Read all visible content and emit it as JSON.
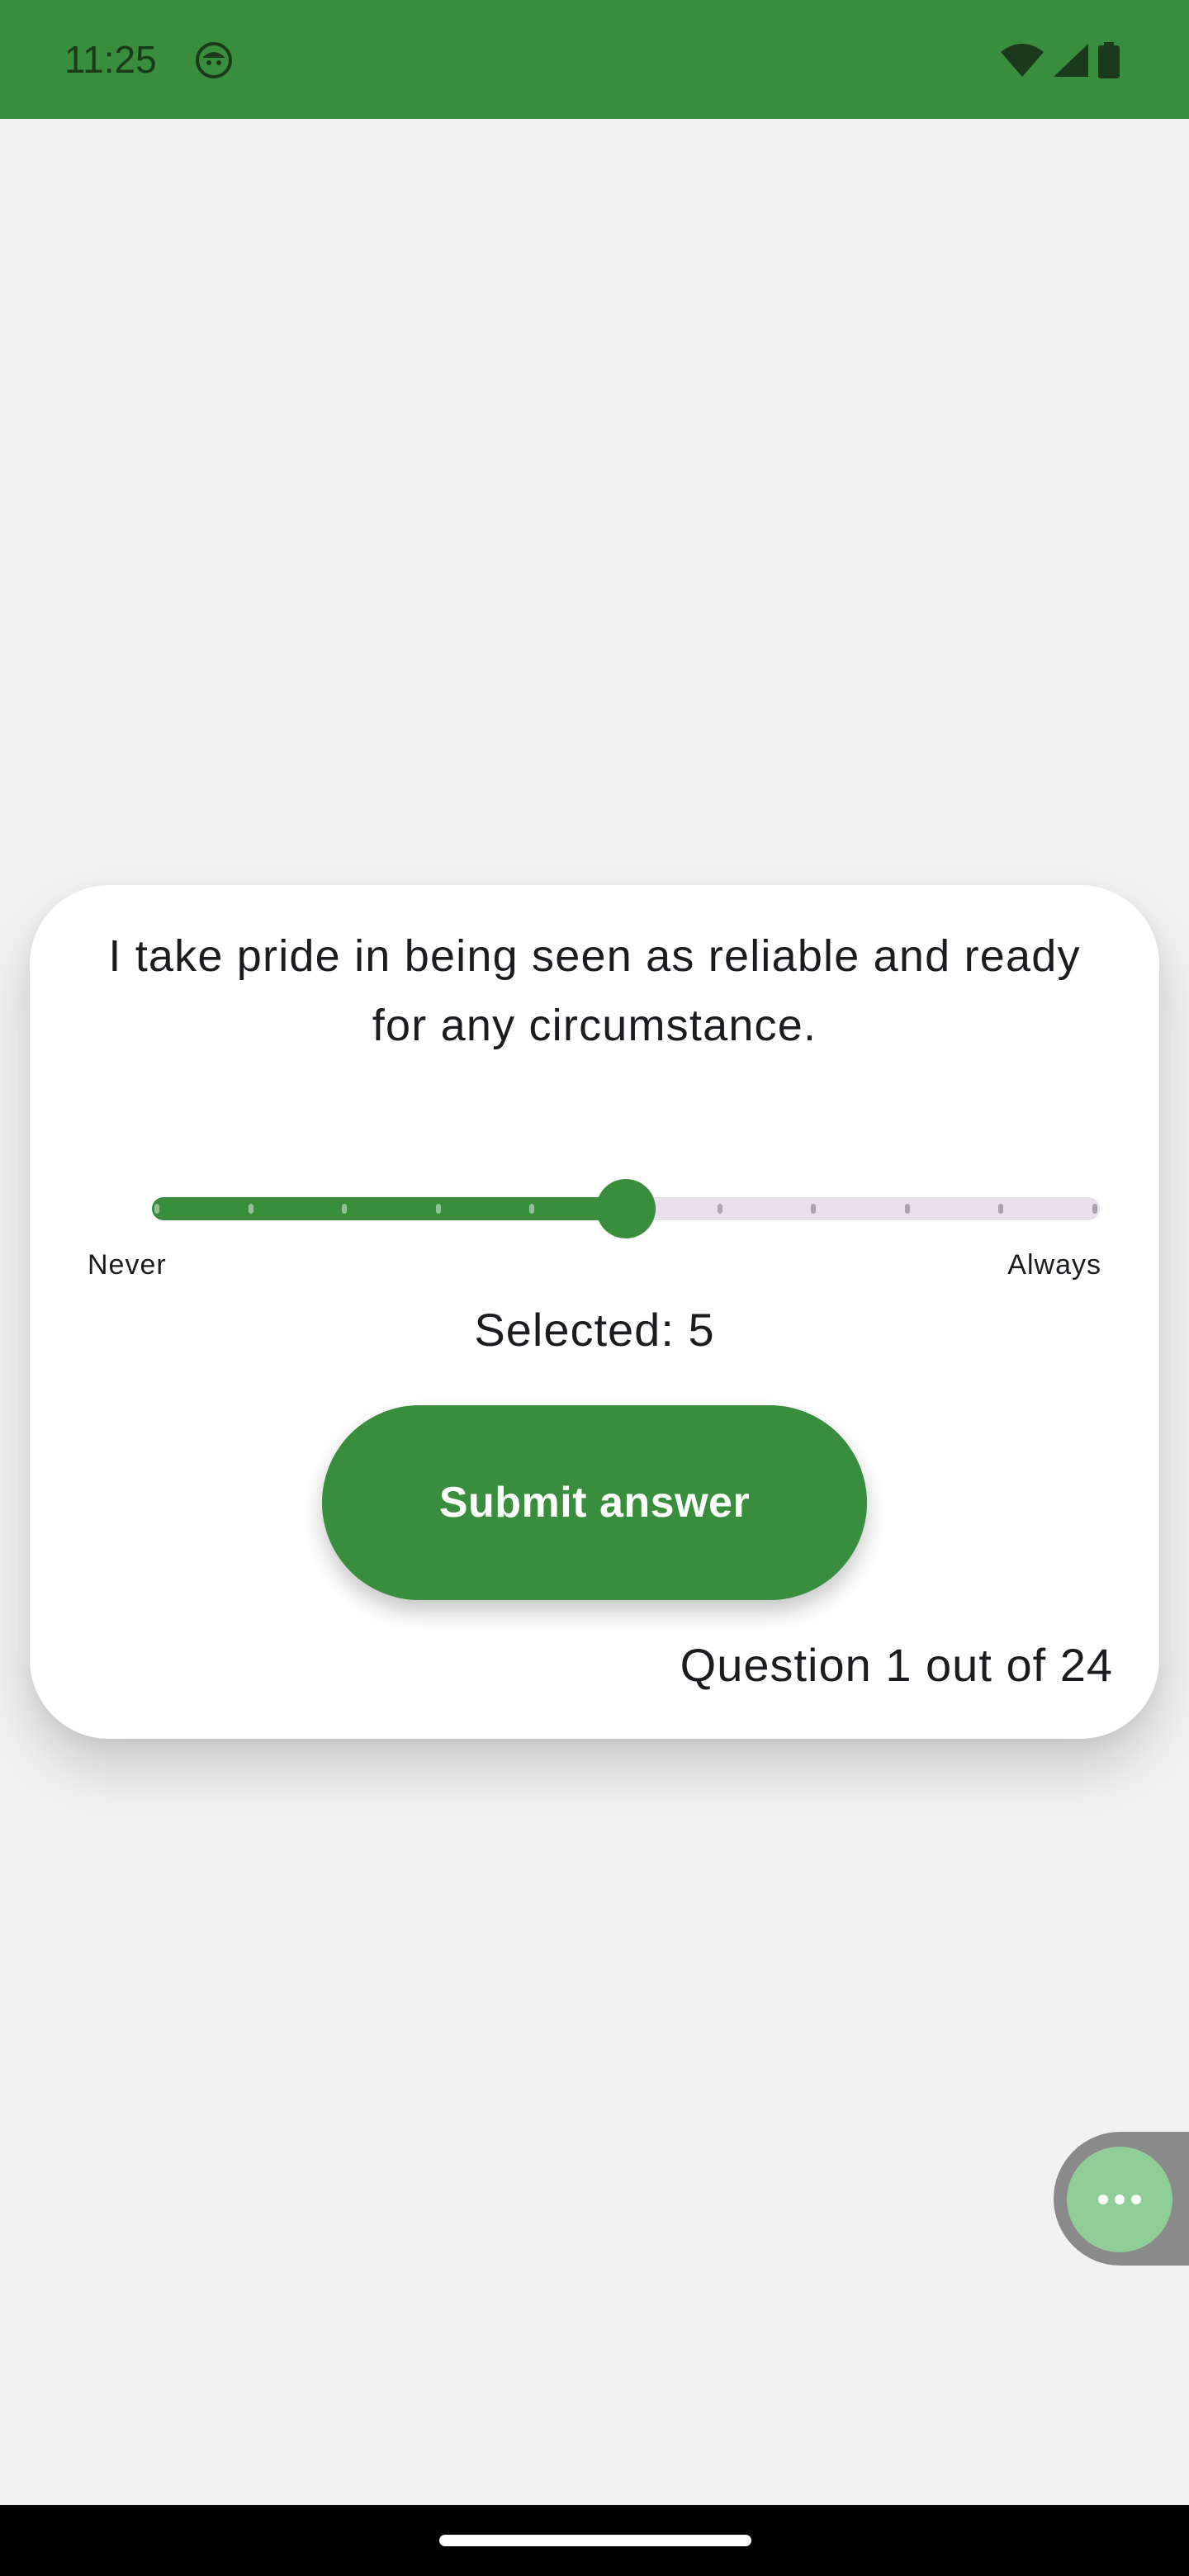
{
  "status_bar": {
    "time": "11:25",
    "app_icon": "android-face-icon",
    "icons": [
      "wifi-icon",
      "cellular-signal-icon",
      "battery-icon"
    ],
    "background_color": "#388e3c"
  },
  "question": {
    "text": "I take pride in being seen as reliable and ready for any circumstance.",
    "counter": "Question 1 out of 24"
  },
  "slider": {
    "min": 0,
    "max": 10,
    "value": 5,
    "min_label": "Never",
    "max_label": "Always",
    "active_color": "#388e3c",
    "inactive_color": "#e7e0ec"
  },
  "selected_text": "Selected: 5",
  "submit_button": {
    "label": "Submit answer"
  },
  "floating_button": {
    "icon": "more-horizontal-icon"
  },
  "colors": {
    "accent": "#388e3c",
    "background": "#f2f2f2",
    "card": "#ffffff"
  }
}
